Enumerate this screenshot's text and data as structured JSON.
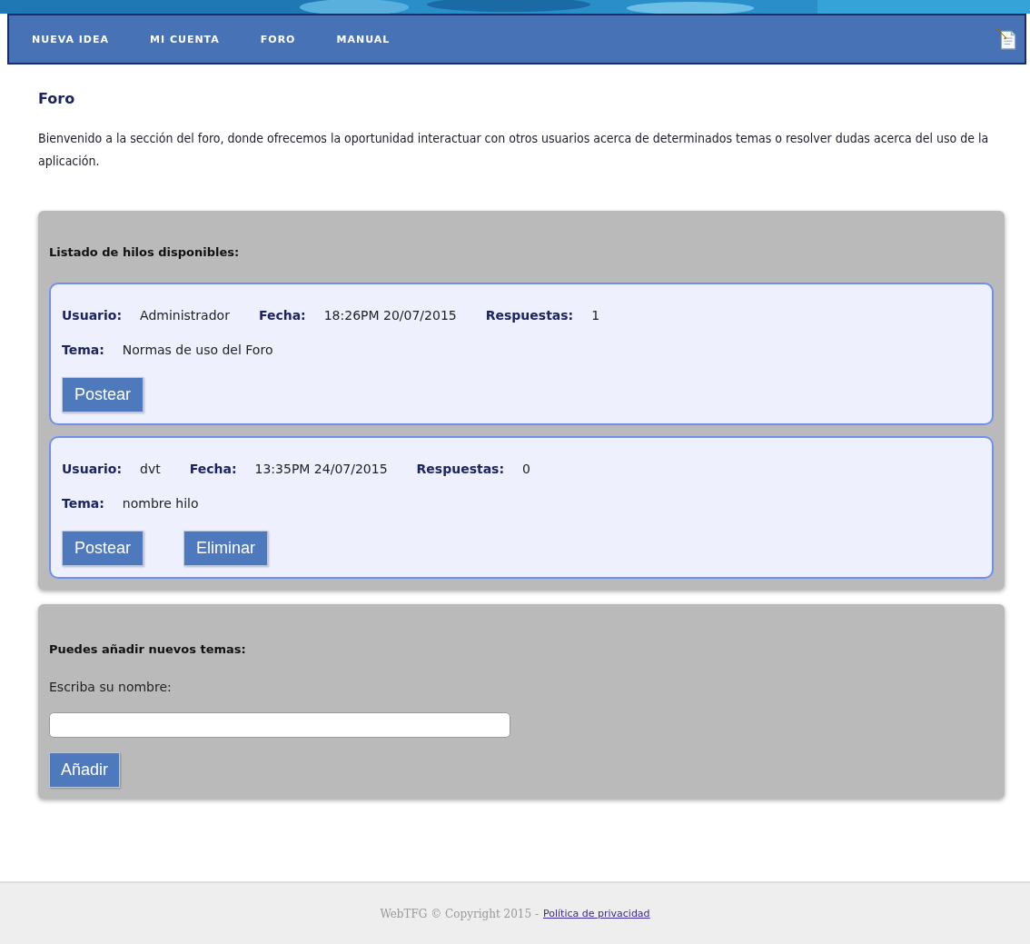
{
  "nav": {
    "items": [
      "NUEVA IDEA",
      "MI CUENTA",
      "FORO",
      "MANUAL"
    ]
  },
  "page": {
    "title": "Foro",
    "intro": "Bienvenido a la sección del foro, donde ofrecemos la oportunidad interactuar con otros usuarios acerca de determinados temas o resolver dudas acerca del uso de la aplicación."
  },
  "threads_panel": {
    "heading": "Listado de hilos disponibles:",
    "threads": [
      {
        "meta": [
          {
            "label": "Usuario:",
            "value": "Administrador"
          },
          {
            "label": "Fecha:",
            "value": "18:26PM 20/07/2015"
          },
          {
            "label": "Respuestas:",
            "value": "1"
          }
        ],
        "topic": {
          "label": "Tema:",
          "value": "Normas de uso del Foro"
        },
        "buttons": [
          "Postear"
        ]
      },
      {
        "meta": [
          {
            "label": "Usuario:",
            "value": "dvt"
          },
          {
            "label": "Fecha:",
            "value": "13:35PM 24/07/2015"
          },
          {
            "label": "Respuestas:",
            "value": "0"
          }
        ],
        "topic": {
          "label": "Tema:",
          "value": "nombre hilo"
        },
        "buttons": [
          "Postear",
          "Eliminar"
        ]
      }
    ]
  },
  "new_topic_panel": {
    "heading": "Puedes añadir nuevos temas:",
    "field_label": "Escriba su nombre:",
    "button": "Añadir"
  },
  "footer": {
    "text": "WebTFG © Copyright 2015 -",
    "link": "Política de privacidad"
  }
}
